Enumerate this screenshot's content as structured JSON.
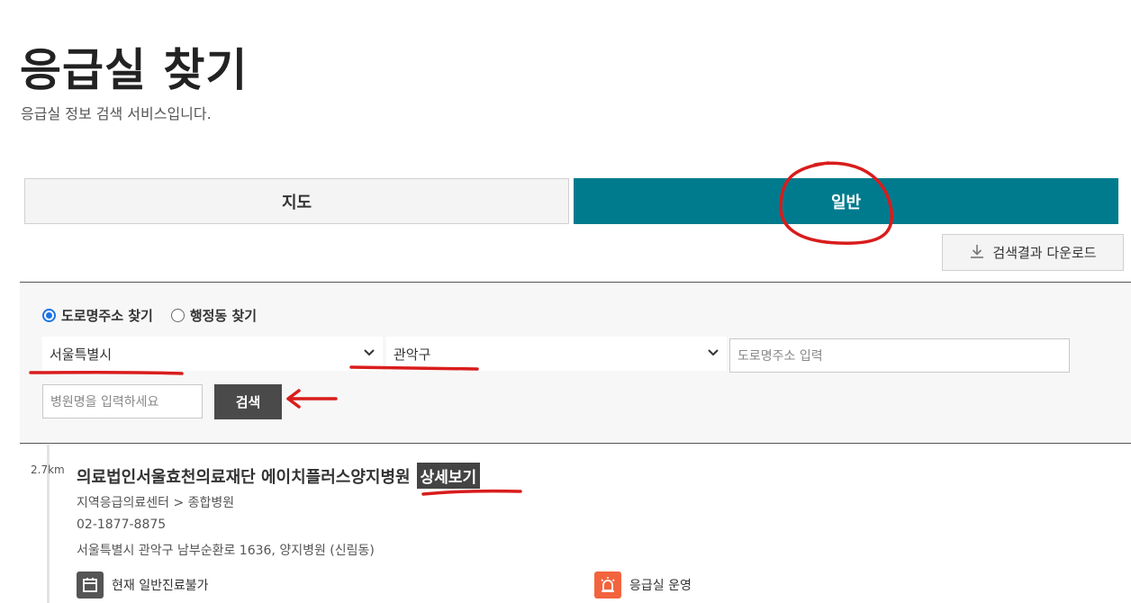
{
  "page": {
    "title": "응급실 찾기",
    "subtitle": "응급실 정보 검색 서비스입니다."
  },
  "tabs": [
    {
      "label": "지도",
      "active": false
    },
    {
      "label": "일반",
      "active": true
    }
  ],
  "download": {
    "label": "검색결과 다운로드",
    "icon": "download-icon"
  },
  "search": {
    "radio_options": [
      {
        "label": "도로명주소 찾기",
        "checked": true
      },
      {
        "label": "행정동 찾기",
        "checked": false
      }
    ],
    "city": "서울특별시",
    "district": "관악구",
    "road_placeholder": "도로명주소 입력",
    "hospital_placeholder": "병원명을 입력하세요",
    "button_label": "검색"
  },
  "results": [
    {
      "distance": "2.7km",
      "name": "의료법인서울효천의료재단 에이치플러스양지병원",
      "detail_label": "상세보기",
      "category": "지역응급의료센터 > 종합병원",
      "phone": "02-1877-8875",
      "address": "서울특별시 관악구 남부순환로 1636, 양지병원 (신림동)",
      "statuses": [
        {
          "label": "현재 일반진료불가",
          "icon": "calendar-icon",
          "color": "#555555"
        },
        {
          "label": "응급실 운영",
          "icon": "siren-icon",
          "color": "#f2643e"
        }
      ]
    }
  ],
  "colors": {
    "accent": "#007b8e",
    "annotation": "#d91c1c"
  }
}
